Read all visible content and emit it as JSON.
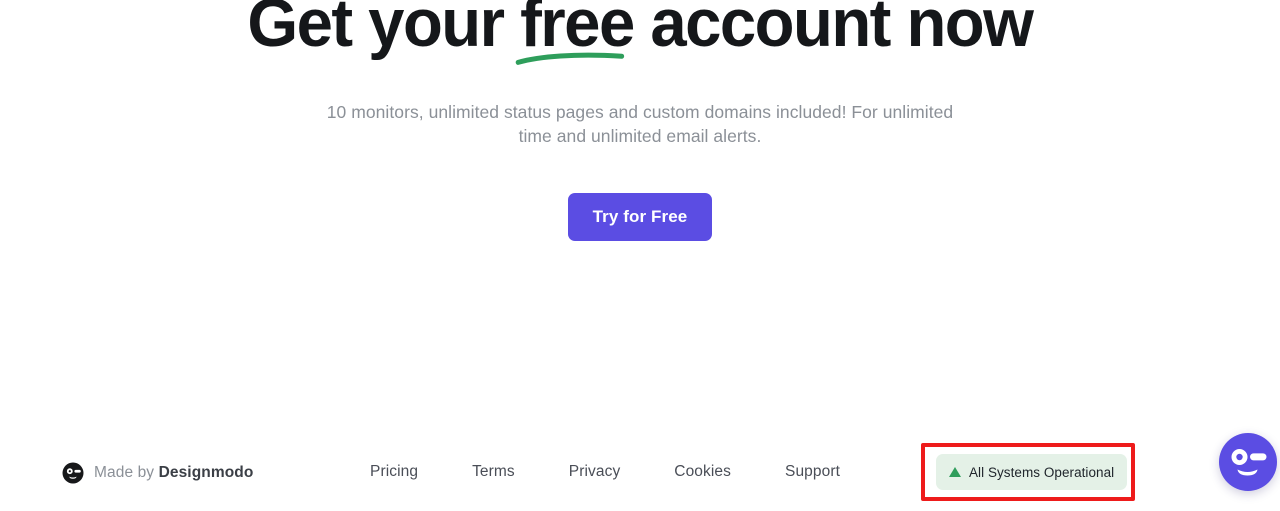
{
  "hero": {
    "headline_part1": "Get your ",
    "headline_highlight": "free",
    "headline_part2": " account now",
    "headline_full": "Get your free account now",
    "subtitle": "10 monitors, unlimited status pages and custom domains included! For unlimited time and unlimited email alerts.",
    "cta_label": "Try for Free",
    "cta_color": "#5B4DE3",
    "underline_color": "#2E9E5B",
    "headline_color": "#15171A",
    "subtitle_color": "#8B9097"
  },
  "footer": {
    "made_by_prefix": "Made by ",
    "made_by_brand": "Designmodo",
    "logo_icon": "designmodo-face-icon",
    "links": [
      {
        "label": "Pricing"
      },
      {
        "label": "Terms"
      },
      {
        "label": "Privacy"
      },
      {
        "label": "Cookies"
      },
      {
        "label": "Support"
      }
    ],
    "link_color": "#4A4E57"
  },
  "status": {
    "label": "All Systems Operational",
    "icon": "green-triangle-up-icon",
    "badge_bg": "#E4F1E7",
    "icon_color": "#2F9E5C",
    "text_color": "#20262C",
    "highlight_color": "#EE1B1B"
  },
  "chat": {
    "icon": "chat-face-icon",
    "bg_color": "#5B4DE3"
  }
}
